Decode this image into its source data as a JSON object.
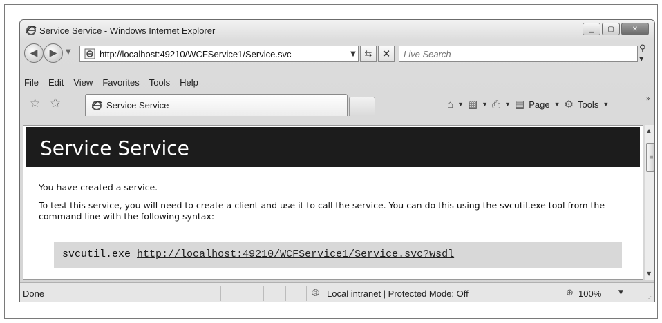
{
  "window": {
    "title": "Service Service - Windows Internet Explorer"
  },
  "address_bar": {
    "url": "http://localhost:49210/WCFService1/Service.svc"
  },
  "search": {
    "placeholder": "Live Search"
  },
  "menu": {
    "items": [
      "File",
      "Edit",
      "View",
      "Favorites",
      "Tools",
      "Help"
    ]
  },
  "tab": {
    "label": "Service Service"
  },
  "command_bar": {
    "page_label": "Page",
    "tools_label": "Tools"
  },
  "page": {
    "heading": "Service Service",
    "intro": "You have created a service.",
    "instructions": "To test this service, you will need to create a client and use it to call the service. You can do this using the svcutil.exe tool from the command line with the following syntax:",
    "command": "svcutil.exe",
    "command_link": "http://localhost:49210/WCFService1/Service.svc?wsdl"
  },
  "status_bar": {
    "status": "Done",
    "zone": "Local intranet | Protected Mode: Off",
    "zoom": "100%"
  },
  "icons": {
    "ie": "ie-logo-icon",
    "back": "back-arrow-icon",
    "forward": "forward-arrow-icon",
    "refresh": "refresh-icon",
    "stop": "stop-icon",
    "search": "search-icon",
    "favorites": "favorites-star-icon",
    "add_favorites": "add-favorites-icon",
    "home": "home-icon",
    "feeds": "feeds-icon",
    "print": "print-icon",
    "page": "page-icon",
    "tools": "gear-icon",
    "zone": "intranet-globe-icon",
    "zoom": "zoom-icon"
  }
}
